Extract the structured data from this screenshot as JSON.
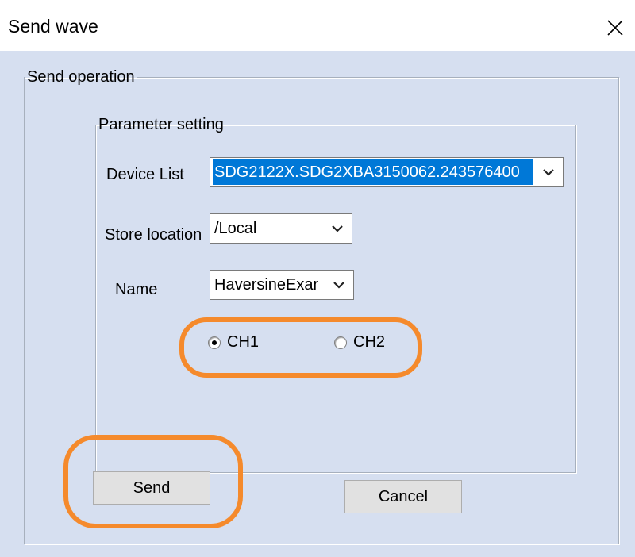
{
  "window": {
    "title": "Send wave",
    "close_symbol": "×"
  },
  "send_operation": {
    "legend": "Send operation"
  },
  "parameter_setting": {
    "legend": "Parameter  setting",
    "device_list": {
      "label": "Device List",
      "value": "SDG2122X.SDG2XBA3150062.243576400"
    },
    "store_location": {
      "label": "Store location",
      "value": "/Local"
    },
    "name": {
      "label": "Name",
      "value": "HaversineExar"
    },
    "channels": [
      {
        "label": "CH1",
        "selected": true
      },
      {
        "label": "CH2",
        "selected": false
      }
    ]
  },
  "buttons": {
    "send": "Send",
    "cancel": "Cancel"
  },
  "colors": {
    "dialog_bg": "#d6dff0",
    "selection": "#0078d7",
    "annotation": "#f58a2c"
  },
  "icons": {
    "close": "close-icon",
    "dropdown": "chevron-down-icon"
  }
}
